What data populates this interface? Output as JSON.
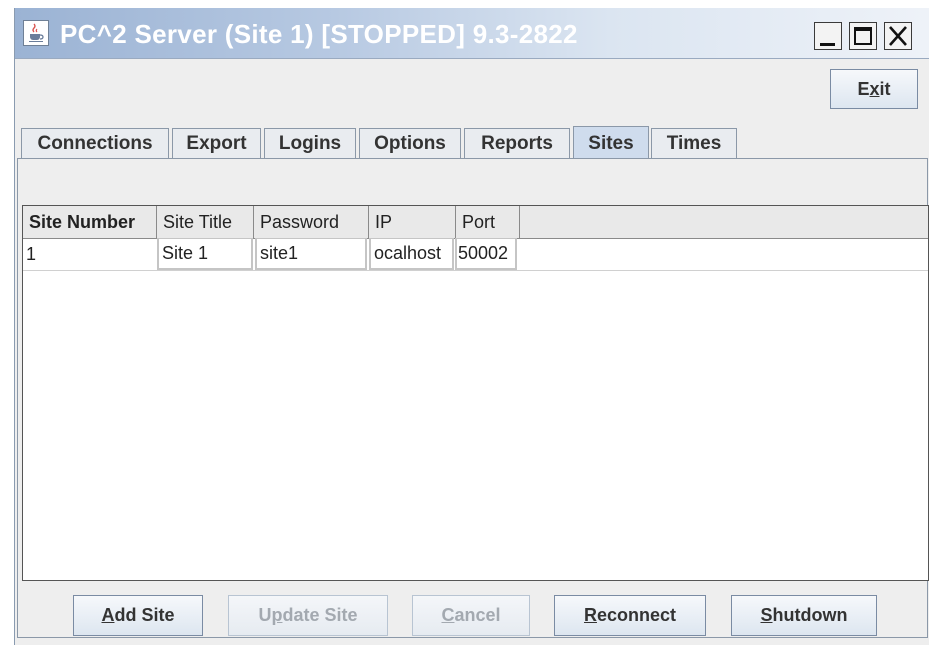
{
  "window": {
    "title": "PC^2 Server (Site 1) [STOPPED] 9.3-2822",
    "controls": {
      "minimize": "_",
      "maximize": "□",
      "close": "X"
    }
  },
  "exit_button": {
    "pre": "E",
    "mn": "x",
    "post": "it"
  },
  "tabs": [
    "Connections",
    "Export",
    "Logins",
    "Options",
    "Reports",
    "Sites",
    "Times"
  ],
  "active_tab": "Sites",
  "table": {
    "columns": [
      "Site Number",
      "Site Title",
      "Password",
      "IP",
      "Port"
    ],
    "rows": [
      [
        "1",
        "Site 1",
        "site1",
        "ocalhost",
        "50002"
      ]
    ]
  },
  "buttons": {
    "add_site": {
      "pre": "",
      "mn": "A",
      "post": "dd Site",
      "enabled": true
    },
    "update_site": {
      "pre": "U",
      "mn": "p",
      "post": "date Site",
      "enabled": false
    },
    "cancel": {
      "pre": "",
      "mn": "C",
      "post": "ancel",
      "enabled": false
    },
    "reconnect": {
      "pre": "",
      "mn": "R",
      "post": "econnect",
      "enabled": true
    },
    "shutdown": {
      "pre": "",
      "mn": "S",
      "post": "hutdown",
      "enabled": true
    }
  }
}
